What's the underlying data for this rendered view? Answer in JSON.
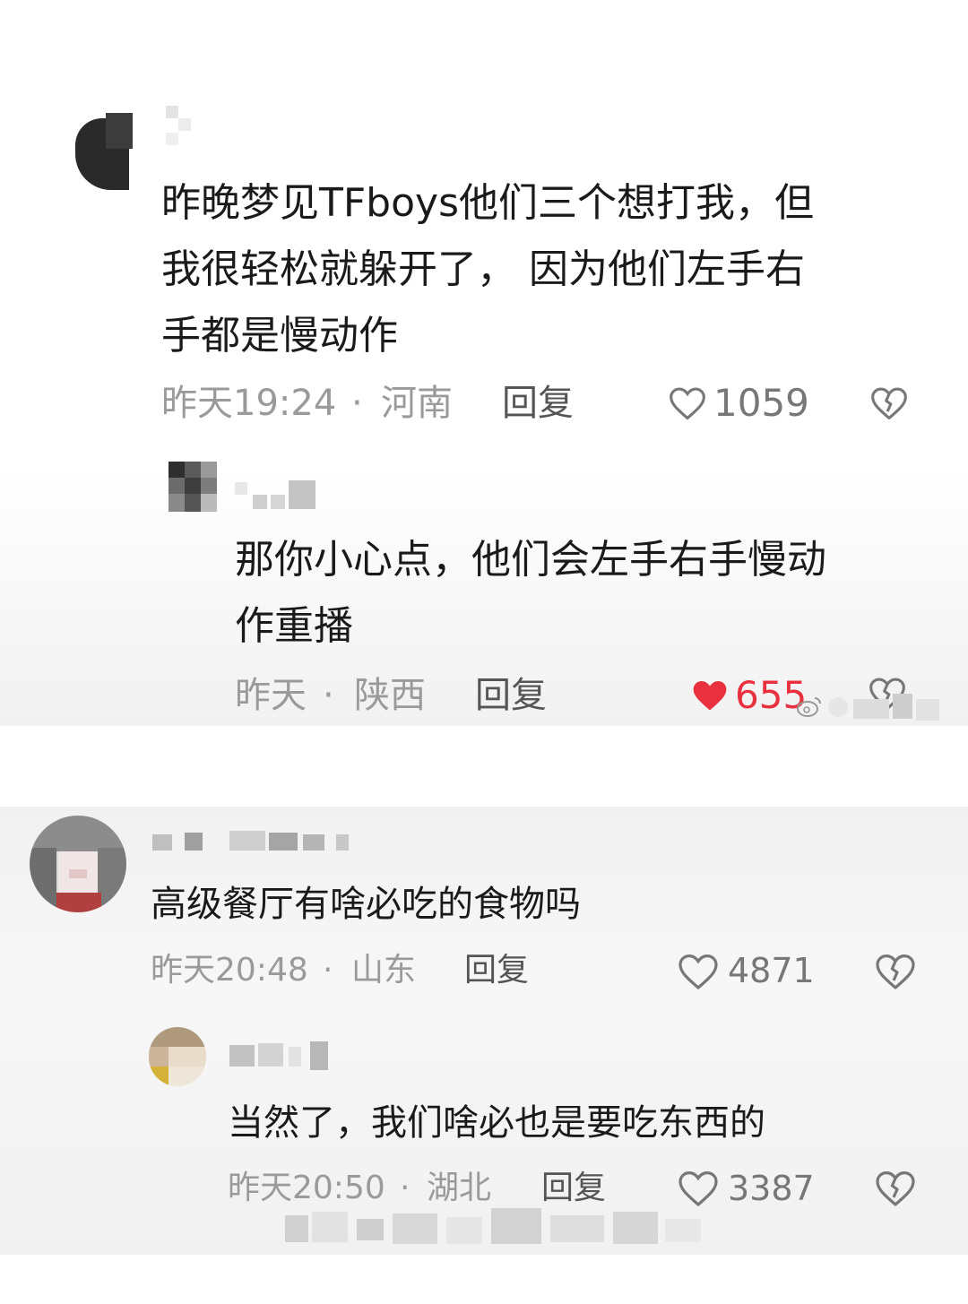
{
  "comments": [
    {
      "text_lines": [
        "昨晚梦见TFboys他们三个想打我，但",
        "我很轻松就躲开了， 因为他们左手右",
        "手都是慢动作"
      ],
      "time": "昨天19:24",
      "sep": "·",
      "location": "河南",
      "reply_label": "回复",
      "likes": "1059",
      "liked": false,
      "reply": {
        "text_lines": [
          "那你小心点，他们会左手右手慢动",
          "作重播"
        ],
        "time": "昨天",
        "sep": "·",
        "location": "陕西",
        "reply_label": "回复",
        "likes": "655",
        "liked": true
      }
    },
    {
      "text_lines": [
        "高级餐厅有啥必吃的食物吗"
      ],
      "time": "昨天20:48",
      "sep": "·",
      "location": "山东",
      "reply_label": "回复",
      "likes": "4871",
      "liked": false,
      "reply": {
        "text_lines": [
          "当然了，我们啥必也是要吃东西的"
        ],
        "time": "昨天20:50",
        "sep": "·",
        "location": "湖北",
        "reply_label": "回复",
        "likes": "3387",
        "liked": false
      }
    }
  ],
  "colors": {
    "text": "#1a1a1a",
    "meta": "#9a9a9a",
    "liked_red": "#e8303f",
    "icon_gray": "#777777"
  },
  "icons": {
    "like": "heart-outline-icon",
    "liked": "heart-filled-icon",
    "dislike": "broken-heart-icon",
    "watermark": "weibo-icon"
  }
}
